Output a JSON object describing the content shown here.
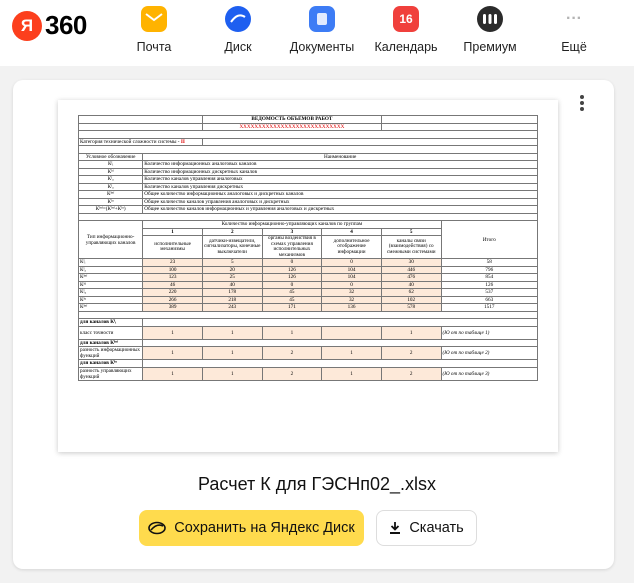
{
  "header": {
    "logo_ya": "Я",
    "logo_360": "360",
    "nav": [
      {
        "label": "Почта",
        "color": "#ffb300",
        "icon": "mail-icon"
      },
      {
        "label": "Диск",
        "color": "#1e5ff0",
        "icon": "disk-icon"
      },
      {
        "label": "Документы",
        "color": "#3d7cf5",
        "icon": "documents-icon"
      },
      {
        "label": "Календарь",
        "color": "#f0403c",
        "icon": "calendar-icon",
        "badge": "16"
      },
      {
        "label": "Премиум",
        "color": "#2b2b2b",
        "icon": "premium-icon"
      },
      {
        "label": "Ещё",
        "color": "#b3b3b3",
        "icon": "more-icon"
      }
    ]
  },
  "document": {
    "title": "ВЕДОМОСТЬ ОБЪЁМОВ РАБОТ",
    "subtitle": "XXXXXXXXXXXXXXXXXXXXXXXXXXXX",
    "category_label": "Категория технической сложности системы -",
    "category_value": "II",
    "legend_head": [
      "Условное обозначение",
      "Наименование"
    ],
    "legend_rows": [
      [
        "Кᴵᵢ",
        "Количество информационных аналоговых каналов"
      ],
      [
        "Кᴵᵈ",
        "Количество информационных дискретных каналов"
      ],
      [
        "Кᴵₐ",
        "Количество каналов управления аналоговых"
      ],
      [
        "Кᴵₐ",
        "Количество каналов управления дискретных"
      ],
      [
        "Кᴵⁿᶠ",
        "Общее количество информационных аналоговых и дискретных каналов"
      ],
      [
        "Кᴵᵘ",
        "Общее количество каналов управления аналоговых и дискретных"
      ],
      [
        "Кᴵⁿᶠ=(Кᴵⁿᶠ+Кᴵᵘ)",
        "Общее количество каналов информационных и управления аналоговых и дискретных"
      ]
    ],
    "group_header": "Количество информационно-управляющих каналов по группам",
    "type_header": "Тип информационно-управляющих каналов",
    "group_numbers": [
      "1",
      "2",
      "3",
      "4",
      "5"
    ],
    "group_names": [
      "исполнительные механизмы",
      "датчики-извещатели, сигнализаторы, конечные выключатели",
      "органы воздействия в схемах управления исполнительных механизмов",
      "дополнительное отображение информации",
      "каналы связи (взаимодействия) со смежными системами"
    ],
    "total_header": "Итого",
    "data_rows": [
      {
        "label": "Кᴵᵢ",
        "values": [
          "23",
          "5",
          "0",
          "0",
          "30",
          "58"
        ]
      },
      {
        "label": "Кᴵₐ",
        "values": [
          "100",
          "20",
          "126",
          "104",
          "446",
          "796"
        ]
      },
      {
        "label": "Кᴵⁿᶠ",
        "values": [
          "123",
          "25",
          "126",
          "104",
          "476",
          "854"
        ]
      },
      {
        "label": "Кᴵᵈ",
        "values": [
          "46",
          "40",
          "0",
          "0",
          "40",
          "126"
        ]
      },
      {
        "label": "Кᴵᵤ",
        "values": [
          "220",
          "178",
          "45",
          "32",
          "62",
          "537"
        ]
      },
      {
        "label": "Кᴵᵘ",
        "values": [
          "266",
          "218",
          "45",
          "32",
          "102",
          "663"
        ]
      },
      {
        "label": "Кᴵⁿᶠ",
        "values": [
          "389",
          "243",
          "171",
          "136",
          "578",
          "1517"
        ]
      }
    ],
    "sections": [
      {
        "title": "для каналов Кᴵᵢ",
        "row_label": "класс точности",
        "values": [
          "1",
          "1",
          "1",
          "",
          "1"
        ],
        "note": "(Ю от по таблице 1)"
      },
      {
        "title": "для каналов Кᴵⁿᶠ",
        "row_label": "разность информационных функций",
        "values": [
          "1",
          "1",
          "2",
          "1",
          "2"
        ],
        "note": "(Ю от по таблице 2)"
      },
      {
        "title": "для каналов Кᴵᵘ",
        "row_label": "разность управляющих функций",
        "values": [
          "1",
          "1",
          "2",
          "1",
          "2"
        ],
        "note": "(Ю от по таблице 3)"
      }
    ]
  },
  "file": {
    "name": "Расчет К для ГЭСНп02_.xlsx"
  },
  "buttons": {
    "save": "Сохранить на Яндекс Диск",
    "download": "Скачать"
  }
}
